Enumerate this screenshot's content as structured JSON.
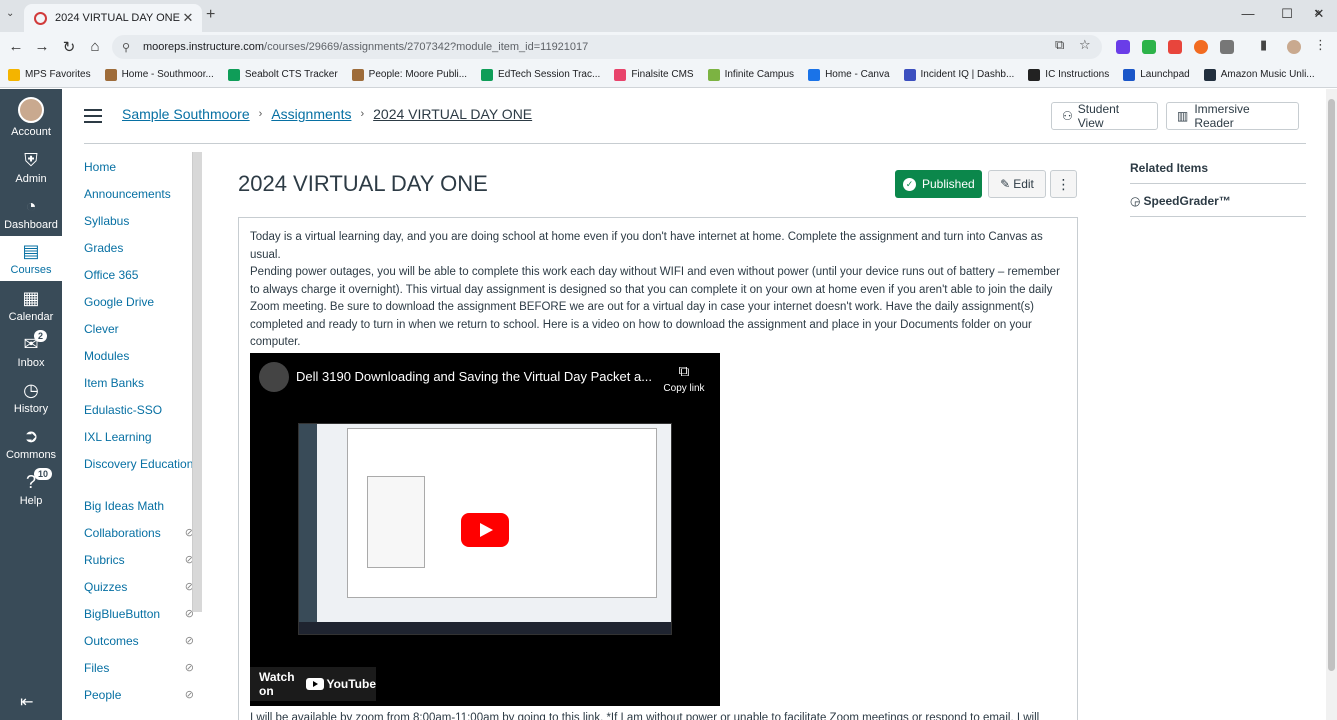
{
  "browser": {
    "tab_title": "2024 VIRTUAL DAY ONE",
    "url_host": "mooreps.instructure.com",
    "url_path": "/courses/29669/assignments/2707342?module_item_id=11921017",
    "bookmarks": [
      {
        "label": "MPS Favorites",
        "color": "#f4b400"
      },
      {
        "label": "Home - Southmoor...",
        "color": "#9e6c3a"
      },
      {
        "label": "Seabolt CTS Tracker",
        "color": "#0f9d58"
      },
      {
        "label": "People: Moore Publi...",
        "color": "#9e6c3a"
      },
      {
        "label": "EdTech Session Trac...",
        "color": "#0f9d58"
      },
      {
        "label": "Finalsite CMS",
        "color": "#e8436b"
      },
      {
        "label": "Infinite Campus",
        "color": "#7cb342"
      },
      {
        "label": "Home - Canva",
        "color": "#1a73e8"
      },
      {
        "label": "Incident IQ | Dashb...",
        "color": "#3c4fbf"
      },
      {
        "label": "IC Instructions",
        "color": "#222222"
      },
      {
        "label": "Launchpad",
        "color": "#1a56c8"
      },
      {
        "label": "Amazon Music Unli...",
        "color": "#222f3e"
      }
    ]
  },
  "global_nav": {
    "account": "Account",
    "admin": "Admin",
    "dashboard": "Dashboard",
    "courses": "Courses",
    "calendar": "Calendar",
    "inbox": "Inbox",
    "inbox_badge": "2",
    "history": "History",
    "commons": "Commons",
    "help": "Help",
    "help_badge": "10"
  },
  "breadcrumb": {
    "course": "Sample Southmoore",
    "section": "Assignments",
    "current": "2024 VIRTUAL DAY ONE"
  },
  "header_buttons": {
    "student_view": "Student View",
    "immersive_reader": "Immersive Reader"
  },
  "course_nav": [
    {
      "label": "Home",
      "hidden": false
    },
    {
      "label": "Announcements",
      "hidden": false
    },
    {
      "label": "Syllabus",
      "hidden": false
    },
    {
      "label": "Grades",
      "hidden": false
    },
    {
      "label": "Office 365",
      "hidden": false
    },
    {
      "label": "Google Drive",
      "hidden": false
    },
    {
      "label": "Clever",
      "hidden": false
    },
    {
      "label": "Modules",
      "hidden": false
    },
    {
      "label": "Item Banks",
      "hidden": false
    },
    {
      "label": "Edulastic-SSO",
      "hidden": false
    },
    {
      "label": "IXL Learning",
      "hidden": false
    },
    {
      "label": "Discovery Education",
      "hidden": false
    },
    {
      "label": "Big Ideas Math",
      "hidden": false
    },
    {
      "label": "Collaborations",
      "hidden": true
    },
    {
      "label": "Rubrics",
      "hidden": true
    },
    {
      "label": "Quizzes",
      "hidden": true
    },
    {
      "label": "BigBlueButton",
      "hidden": true
    },
    {
      "label": "Outcomes",
      "hidden": true
    },
    {
      "label": "Files",
      "hidden": true
    },
    {
      "label": "People",
      "hidden": true
    }
  ],
  "assignment": {
    "title": "2024 VIRTUAL DAY ONE",
    "published_label": "Published",
    "edit_label": "Edit",
    "para1": "Today is a virtual learning day, and you are doing school at home even if you don't have internet at home. Complete the assignment and turn into Canvas as usual.",
    "para2": "Pending power outages, you will be able to complete this work each day without WIFI and even without power (until your device runs out of battery – remember to always charge it overnight). This virtual day assignment is designed so that you can complete it on your own at home even if you aren't able to join the daily Zoom meeting. Be sure to download the assignment BEFORE we are out for a virtual day in case your internet doesn't work. Have the daily assignment(s) completed and ready to turn in when we return to school. Here is a video on how to download the assignment and place in your Documents folder on your computer.",
    "para3": "I will be available by zoom from 8:00am-11:00am by going to this link. *If I am without power or unable to facilitate Zoom meetings or respond to email, I will",
    "video": {
      "title": "Dell 3190 Downloading and Saving the Virtual Day Packet a...",
      "copy_link": "Copy link",
      "watch_on": "Watch on",
      "youtube": "YouTube"
    }
  },
  "related": {
    "heading": "Related Items",
    "speedgrader": "SpeedGrader™"
  }
}
